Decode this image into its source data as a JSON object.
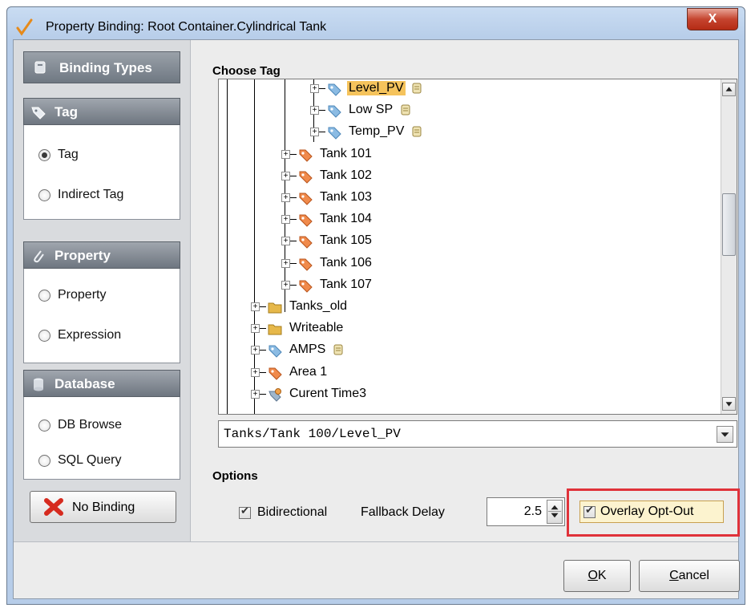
{
  "window": {
    "title": "Property Binding: Root Container.Cylindrical Tank",
    "close_label": "X"
  },
  "binding_types": {
    "header": "Binding Types",
    "groups": [
      {
        "title": "Tag",
        "icon": "tag-icon",
        "options": [
          {
            "label": "Tag",
            "selected": true
          },
          {
            "label": "Indirect Tag",
            "selected": false
          }
        ]
      },
      {
        "title": "Property",
        "icon": "paperclip-icon",
        "options": [
          {
            "label": "Property",
            "selected": false
          },
          {
            "label": "Expression",
            "selected": false
          }
        ]
      },
      {
        "title": "Database",
        "icon": "database-icon",
        "options": [
          {
            "label": "DB Browse",
            "selected": false
          },
          {
            "label": "SQL Query",
            "selected": false
          }
        ]
      }
    ],
    "no_binding_label": "No Binding"
  },
  "choose_tag": {
    "title": "Choose Tag",
    "tree": [
      {
        "label": "Level_PV",
        "icon": "memory-tag-icon",
        "selected": true,
        "has_script": true
      },
      {
        "label": "Low SP",
        "icon": "memory-tag-icon",
        "selected": false,
        "has_script": true
      },
      {
        "label": "Temp_PV",
        "icon": "memory-tag-icon",
        "selected": false,
        "has_script": true
      },
      {
        "label": "Tank 101",
        "icon": "udt-tag-icon",
        "selected": false,
        "has_script": false
      },
      {
        "label": "Tank 102",
        "icon": "udt-tag-icon",
        "selected": false,
        "has_script": false
      },
      {
        "label": "Tank 103",
        "icon": "udt-tag-icon",
        "selected": false,
        "has_script": false
      },
      {
        "label": "Tank 104",
        "icon": "udt-tag-icon",
        "selected": false,
        "has_script": false
      },
      {
        "label": "Tank 105",
        "icon": "udt-tag-icon",
        "selected": false,
        "has_script": false
      },
      {
        "label": "Tank 106",
        "icon": "udt-tag-icon",
        "selected": false,
        "has_script": false
      },
      {
        "label": "Tank 107",
        "icon": "udt-tag-icon",
        "selected": false,
        "has_script": false
      },
      {
        "label": "Tanks_old",
        "icon": "folder-icon",
        "selected": false,
        "has_script": false
      },
      {
        "label": "Writeable",
        "icon": "folder-icon",
        "selected": false,
        "has_script": false
      },
      {
        "label": "AMPS",
        "icon": "memory-tag-icon",
        "selected": false,
        "has_script": true
      },
      {
        "label": "Area 1",
        "icon": "udt-tag-icon",
        "selected": false,
        "has_script": false
      },
      {
        "label": "Curent Time3",
        "icon": "expression-tag-icon",
        "selected": false,
        "has_script": false
      }
    ],
    "path": "Tanks/Tank 100/Level_PV"
  },
  "options": {
    "title": "Options",
    "bidirectional": {
      "label": "Bidirectional",
      "checked": true
    },
    "fallback_delay": {
      "label": "Fallback Delay",
      "value": "2.5"
    },
    "overlay_opt_out": {
      "label": "Overlay Opt-Out",
      "checked": true
    }
  },
  "buttons": {
    "ok": "OK",
    "cancel": "Cancel"
  },
  "colors": {
    "highlight": "#e0323a",
    "selection": "#f5c35c",
    "udt_tag": "#f08a4b",
    "memory_tag": "#8bbbe3",
    "folder": "#e6b84a"
  }
}
